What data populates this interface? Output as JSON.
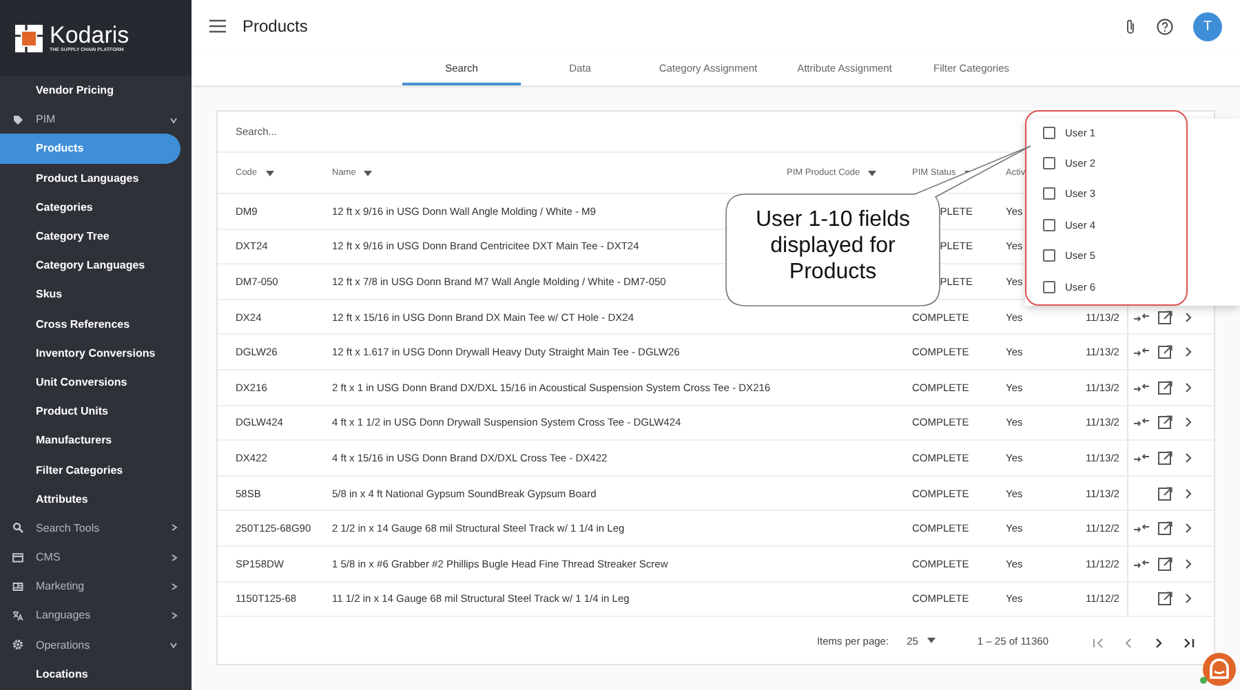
{
  "sidebar": {
    "logo": {
      "name": "Kodaris",
      "tagline": "THE SUPPLY CHAIN PLATFORM"
    },
    "items": [
      {
        "label": "Vendor Pricing",
        "kind": "link",
        "selected": false
      },
      {
        "label": "PIM",
        "kind": "group",
        "expanded": true,
        "children": [
          {
            "label": "Products",
            "selected": true
          },
          {
            "label": "Product Languages",
            "selected": false
          },
          {
            "label": "Categories",
            "selected": false
          },
          {
            "label": "Category Tree",
            "selected": false
          },
          {
            "label": "Category Languages",
            "selected": false
          },
          {
            "label": "Skus",
            "selected": false
          },
          {
            "label": "Cross References",
            "selected": false
          },
          {
            "label": "Inventory Conversions",
            "selected": false
          },
          {
            "label": "Unit Conversions",
            "selected": false
          },
          {
            "label": "Product Units",
            "selected": false
          },
          {
            "label": "Manufacturers",
            "selected": false
          },
          {
            "label": "Filter Categories",
            "selected": false
          },
          {
            "label": "Attributes",
            "selected": false
          }
        ]
      },
      {
        "label": "Search Tools",
        "kind": "group",
        "expanded": false
      },
      {
        "label": "CMS",
        "kind": "group",
        "expanded": false
      },
      {
        "label": "Marketing",
        "kind": "group",
        "expanded": false
      },
      {
        "label": "Languages",
        "kind": "group",
        "expanded": false
      },
      {
        "label": "Operations",
        "kind": "group",
        "expanded": true,
        "children": [
          {
            "label": "Locations",
            "selected": false
          }
        ]
      }
    ]
  },
  "header": {
    "title": "Products",
    "avatar": "T"
  },
  "tabs": [
    {
      "label": "Search",
      "selected": true
    },
    {
      "label": "Data",
      "selected": false
    },
    {
      "label": "Category Assignment",
      "selected": false
    },
    {
      "label": "Attribute Assignment",
      "selected": false
    },
    {
      "label": "Filter Categories",
      "selected": false
    }
  ],
  "table": {
    "search": {
      "placeholder": "Search..."
    },
    "columns": [
      {
        "label": "Code",
        "sortable": true
      },
      {
        "label": "Name",
        "sortable": true
      },
      {
        "label": "PIM Product Code",
        "sortable": true
      },
      {
        "label": "PIM Status",
        "sortable": true
      },
      {
        "label": "Activ",
        "sortable": false
      }
    ],
    "rows": [
      {
        "code": "DM9",
        "name": "12 ft x 9/16 in USG Donn Wall Angle Molding / White - M9",
        "status": "PLETE",
        "active": "Yes",
        "covered": true
      },
      {
        "code": "DXT24",
        "name": "12 ft x 9/16 in USG Donn Brand Centricitee DXT Main Tee - DXT24",
        "status": "PLETE",
        "active": "Yes",
        "covered": true
      },
      {
        "code": "DM7-050",
        "name": "12 ft x 7/8 in USG Donn Brand M7 Wall Angle Molding / White - DM7-050",
        "status": "PLETE",
        "active": "Yes",
        "covered": true
      },
      {
        "code": "DX24",
        "name": "12 ft x 15/16 in USG Donn Brand DX Main Tee w/ CT Hole - DX24",
        "status": "COMPLETE",
        "active": "Yes",
        "date": "11/13/2",
        "covered": false,
        "compare": true
      },
      {
        "code": "DGLW26",
        "name": "12 ft x 1.617 in USG Donn Drywall Heavy Duty Straight Main Tee - DGLW26",
        "status": "COMPLETE",
        "active": "Yes",
        "date": "11/13/2",
        "covered": false,
        "compare": true
      },
      {
        "code": "DX216",
        "name": "2 ft x 1 in USG Donn Brand DX/DXL 15/16 in Acoustical Suspension System Cross Tee - DX216",
        "status": "COMPLETE",
        "active": "Yes",
        "date": "11/13/2",
        "covered": false,
        "compare": true
      },
      {
        "code": "DGLW424",
        "name": "4 ft x 1 1/2 in USG Donn Drywall Suspension System Cross Tee - DGLW424",
        "status": "COMPLETE",
        "active": "Yes",
        "date": "11/13/2",
        "covered": false,
        "compare": true
      },
      {
        "code": "DX422",
        "name": "4 ft x 15/16 in USG Donn Brand DX/DXL Cross Tee - DX422",
        "status": "COMPLETE",
        "active": "Yes",
        "date": "11/13/2",
        "covered": false,
        "compare": true
      },
      {
        "code": "58SB",
        "name": "5/8 in x 4 ft National Gypsum SoundBreak Gypsum Board",
        "status": "COMPLETE",
        "active": "Yes",
        "date": "11/13/2",
        "covered": false,
        "compare": false
      },
      {
        "code": "250T125-68G90",
        "name": "2 1/2 in x 14 Gauge 68 mil Structural Steel Track w/ 1 1/4 in Leg",
        "status": "COMPLETE",
        "active": "Yes",
        "date": "11/12/2",
        "covered": false,
        "compare": true
      },
      {
        "code": "SP158DW",
        "name": "1 5/8 in x #6 Grabber #2 Phillips Bugle Head Fine Thread Streaker Screw",
        "status": "COMPLETE",
        "active": "Yes",
        "date": "11/12/2",
        "covered": false,
        "compare": true
      },
      {
        "code": "1150T125-68",
        "name": "11 1/2 in x 14 Gauge 68 mil Structural Steel Track w/ 1 1/4 in Leg",
        "status": "COMPLETE",
        "active": "Yes",
        "date": "11/12/2",
        "covered": false,
        "compare": false
      }
    ],
    "pagination": {
      "label": "Items per page:",
      "page_size": "25",
      "range": "1 – 25 of 11360"
    }
  },
  "column_menu": {
    "items": [
      {
        "label": "User 1",
        "checked": false
      },
      {
        "label": "User 2",
        "checked": false
      },
      {
        "label": "User 3",
        "checked": false
      },
      {
        "label": "User 4",
        "checked": false
      },
      {
        "label": "User 5",
        "checked": false
      },
      {
        "label": "User 6",
        "checked": false
      }
    ]
  },
  "callout": {
    "text": "User 1-10 fields displayed for Products"
  },
  "chat": {
    "online": true
  }
}
